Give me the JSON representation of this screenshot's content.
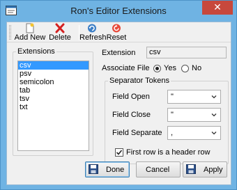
{
  "window": {
    "title": "Ron's Editor Extensions",
    "close_glyph": "✕"
  },
  "toolbar": {
    "add_new": "Add New",
    "delete": "Delete",
    "refresh": "Refresh",
    "reset": "Reset"
  },
  "extensions": {
    "label": "Extensions",
    "items": [
      "csv",
      "psv",
      "semicolon",
      "tab",
      "tsv",
      "txt"
    ],
    "selected": "csv"
  },
  "details": {
    "extension_label": "Extension",
    "extension_value": "csv",
    "associate_label": "Associate File",
    "yes_label": "Yes",
    "no_label": "No",
    "associate_value": "Yes"
  },
  "separator": {
    "label": "Separator Tokens",
    "field_open_label": "Field Open",
    "field_open_value": "\"",
    "field_close_label": "Field Close",
    "field_close_value": "\"",
    "field_separate_label": "Field Separate",
    "field_separate_value": ",",
    "header_row_label": "First row is a header row",
    "header_row_checked": true
  },
  "buttons": {
    "done": "Done",
    "cancel": "Cancel",
    "apply": "Apply"
  },
  "colors": {
    "titlebar": "#6fb3e3",
    "close": "#c7483c",
    "selection": "#3399ff"
  }
}
